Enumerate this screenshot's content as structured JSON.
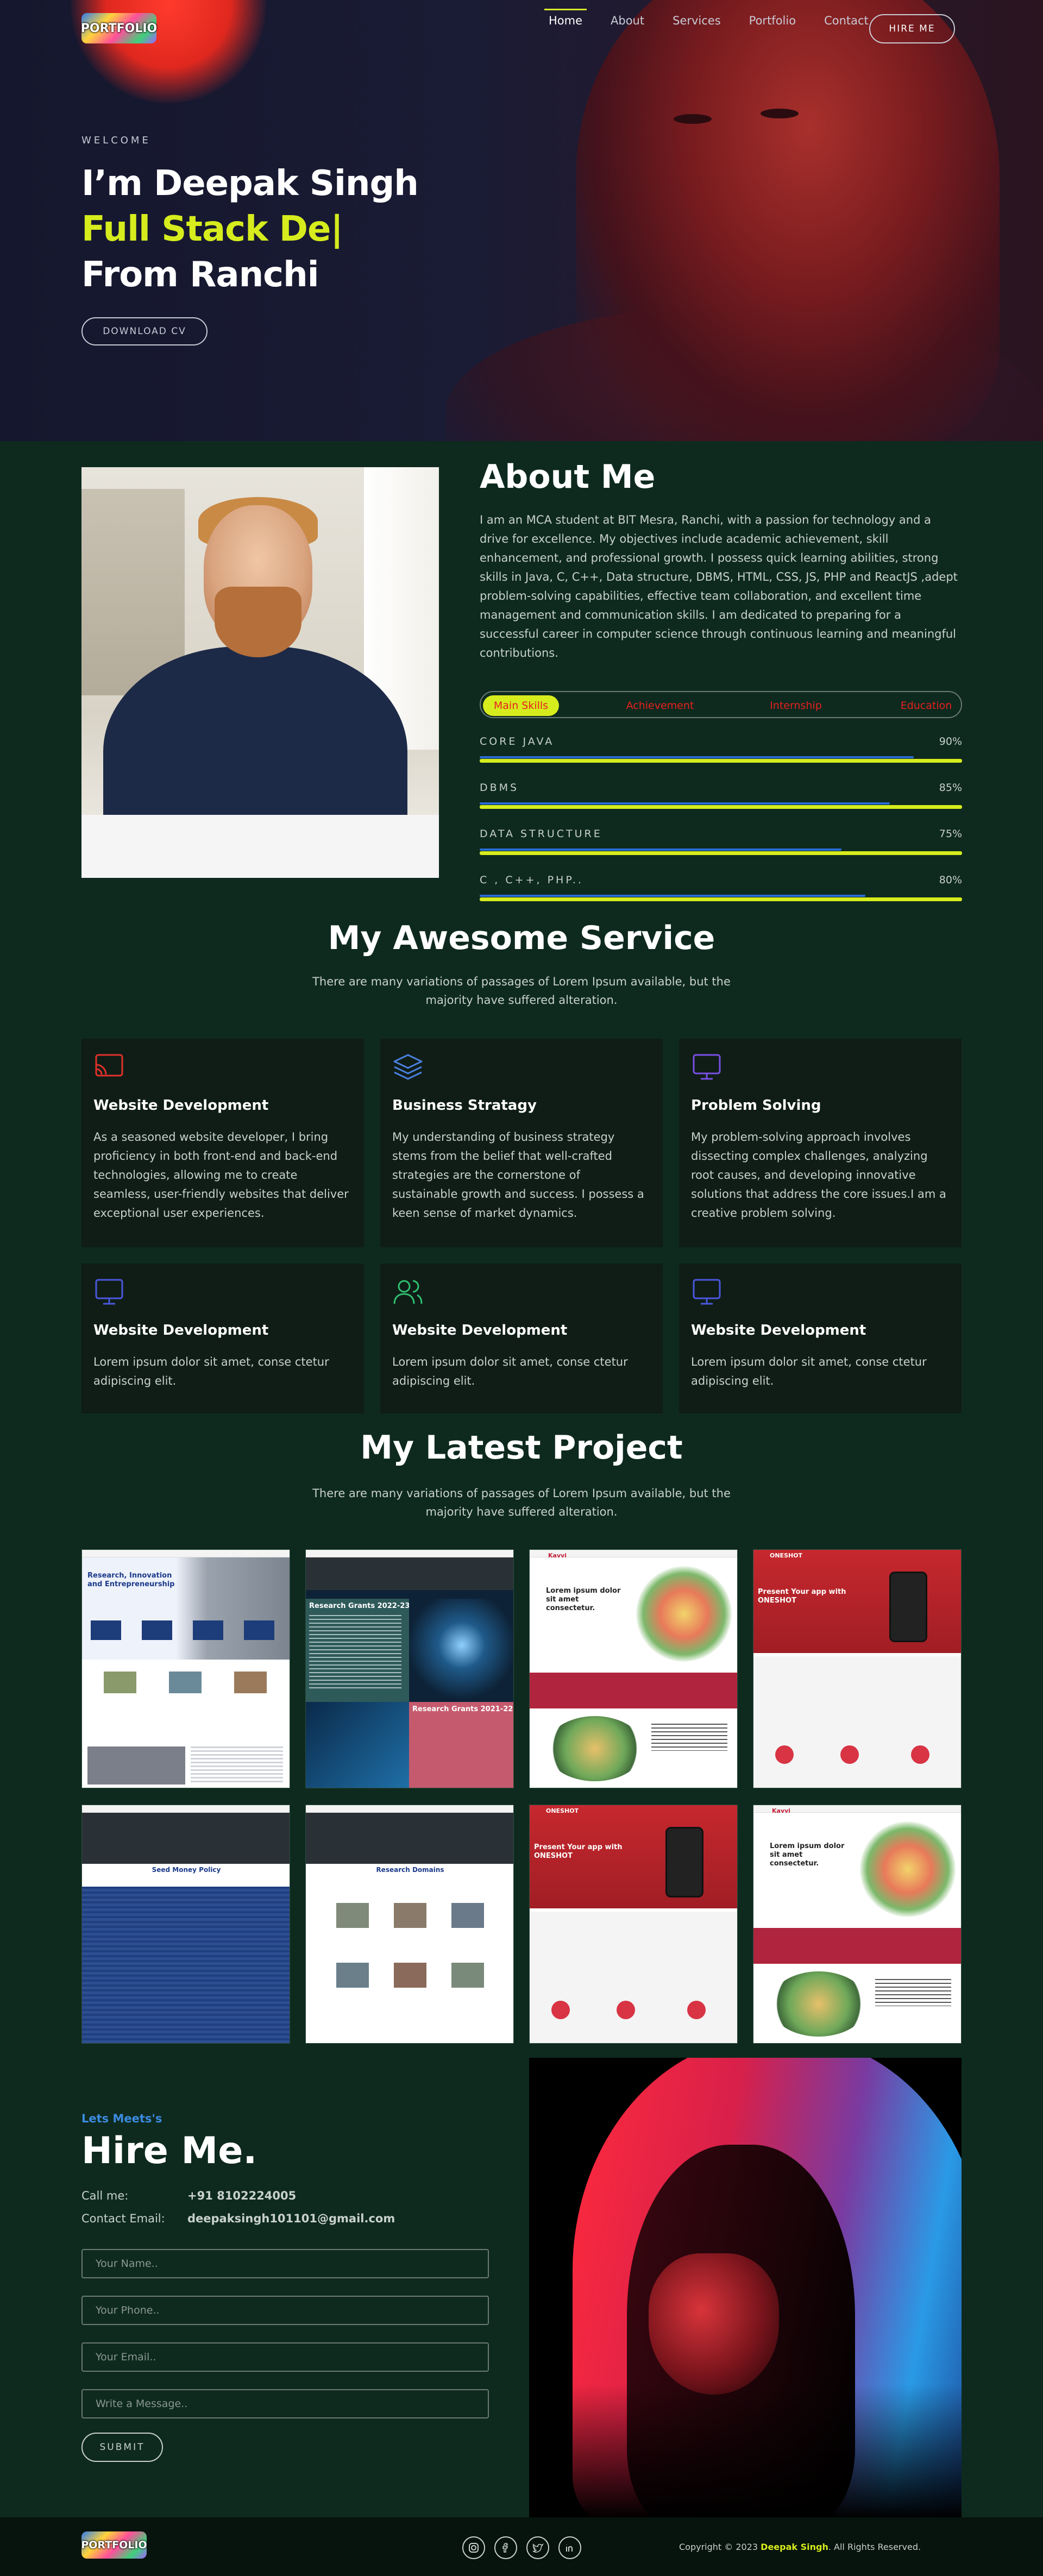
{
  "brand": {
    "logo_text": "PORTFOLIO"
  },
  "nav": {
    "items": [
      "Home",
      "About",
      "Services",
      "Portfolio",
      "Contact"
    ],
    "hire_button": "HIRE ME"
  },
  "hero": {
    "welcome": "WELCOME",
    "line1": "I’m Deepak Singh",
    "line2": "Full Stack De|",
    "line3": "From Ranchi",
    "download_button": "DOWNLOAD CV"
  },
  "about": {
    "title": "About Me",
    "text": "I am an MCA student at BIT Mesra, Ranchi, with a passion for technology and a drive for excellence. My objectives include academic achievement, skill enhancement, and professional growth. I possess quick learning abilities, strong skills in Java, C, C++, Data structure, DBMS, HTML, CSS, JS, PHP and ReactJS ,adept problem-solving capabilities, effective team collaboration, and excellent time management and communication skills. I am dedicated to preparing for a successful career in computer science through continuous learning and meaningful contributions.",
    "tabs": [
      "Main Skills",
      "Achievement",
      "Internship",
      "Education"
    ],
    "skills": [
      {
        "name": "CORE JAVA",
        "pct_label": "90%",
        "value": 0.9
      },
      {
        "name": "DBMS",
        "pct_label": "85%",
        "value": 0.85
      },
      {
        "name": "DATA STRUCTURE",
        "pct_label": "75%",
        "value": 0.75
      },
      {
        "name": "C , C++, PHP..",
        "pct_label": "80%",
        "value": 0.8
      }
    ]
  },
  "services": {
    "title": "My Awesome Service",
    "subtitle": "There are many variations of passages of Lorem Ipsum available, but the majority have suffered alteration.",
    "cards": [
      {
        "icon": "cast-icon",
        "title": "Website Development",
        "text": "As a seasoned website developer, I bring proficiency in both front-end and back-end technologies, allowing me to create seamless, user-friendly websites that deliver exceptional user experiences."
      },
      {
        "icon": "layers-icon",
        "title": "Business Stratagy",
        "text": "My understanding of business strategy stems from the belief that well-crafted strategies are the cornerstone of sustainable growth and success. I possess a keen sense of market dynamics."
      },
      {
        "icon": "monitor-icon",
        "title": "Problem Solving",
        "text": "My problem-solving approach involves dissecting complex challenges, analyzing root causes, and developing innovative solutions that address the core issues.I am a creative problem solving."
      },
      {
        "icon": "monitor-icon",
        "title": "Website Development",
        "text": "Lorem ipsum dolor sit amet, conse ctetur adipiscing elit."
      },
      {
        "icon": "users-icon",
        "title": "Website Development",
        "text": "Lorem ipsum dolor sit amet, conse ctetur adipiscing elit."
      },
      {
        "icon": "monitor-icon",
        "title": "Website Development",
        "text": "Lorem ipsum dolor sit amet, conse ctetur adipiscing elit."
      }
    ]
  },
  "projects": {
    "title": "My Latest Project",
    "subtitle": "There are many variations of passages of Lorem Ipsum available, but the majority have suffered alteration.",
    "items": [
      {
        "kind": "research",
        "heading": "Research, Innovation and Entrepreneurship"
      },
      {
        "kind": "grants",
        "heading": "Research Grants 2022-23",
        "heading2": "Research Grants 2021-22"
      },
      {
        "kind": "food",
        "heading": "Lorem ipsum dolor sit amet consectetur.",
        "brand": "Kavvi"
      },
      {
        "kind": "app",
        "heading": "Present Your app with ONESHOT",
        "brand": "ONESHOT"
      },
      {
        "kind": "policy",
        "heading": "Seed Money Policy"
      },
      {
        "kind": "domains",
        "heading": "Research Domains"
      },
      {
        "kind": "app",
        "heading": "Present Your app with ONESHOT",
        "brand": "ONESHOT"
      },
      {
        "kind": "food",
        "heading": "Lorem ipsum dolor sit amet consectetur.",
        "brand": "Kavvi"
      }
    ]
  },
  "contact": {
    "kicker": "Lets Meets's",
    "title": "Hire Me.",
    "call_label": "Call me:",
    "call_value": "+91 8102224005",
    "email_label": "Contact Email:",
    "email_value": "deepaksingh101101@gmail.com",
    "placeholders": {
      "name": "Your Name..",
      "phone": "Your Phone..",
      "email": "Your Email..",
      "message": "Write a Message.."
    },
    "submit": "SUBMIT"
  },
  "footer": {
    "social": [
      "instagram-icon",
      "facebook-icon",
      "twitter-icon",
      "linkedin-icon"
    ],
    "copy_prefix": "Copyright © 2023",
    "copy_name": "Deepak Singh",
    "copy_suffix": ". All Rights Reserved."
  },
  "colors": {
    "accent": "#d6ec1d",
    "bg_section": "#0e2a1f",
    "hero_bg": "#15172e",
    "tab_text": "#e8201f",
    "bar_fill": "#2a6cd6"
  }
}
